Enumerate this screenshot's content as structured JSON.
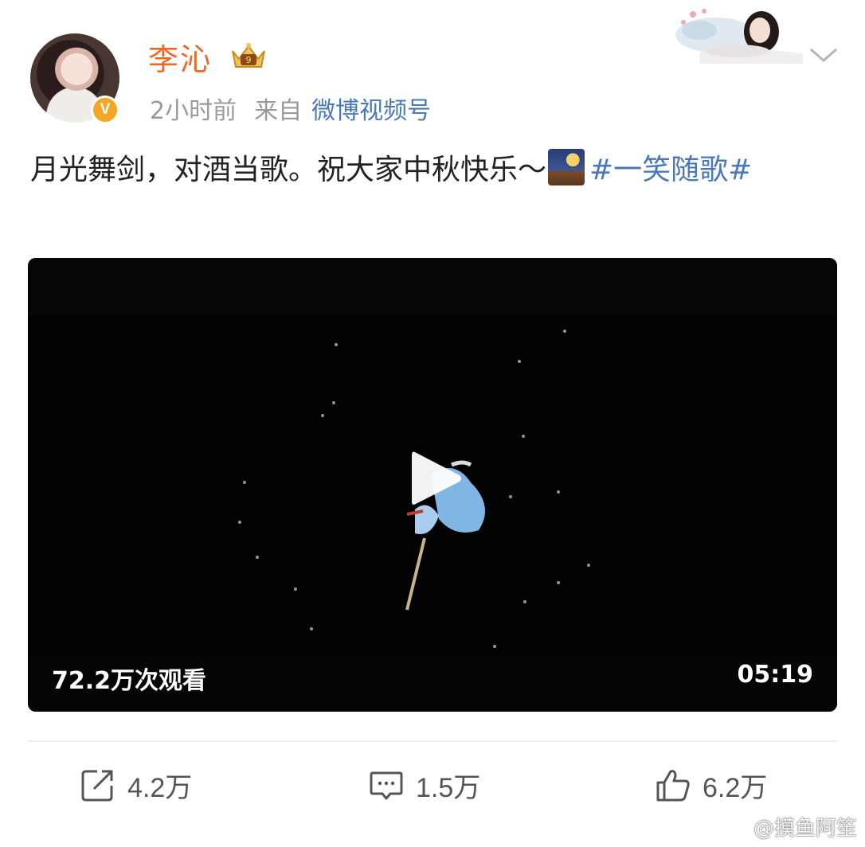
{
  "user": {
    "name": "李沁",
    "verified_badge": "V",
    "time": "2小时前",
    "source_prefix": "来自",
    "source": "微博视频号"
  },
  "post": {
    "text": "月光舞剑，对酒当歌。祝大家中秋快乐～",
    "emoji": "moon-festival-emoji",
    "topic": "#一笑随歌#"
  },
  "video": {
    "views": "72.2万次观看",
    "duration": "05:19",
    "play_icon": "play-icon"
  },
  "actions": {
    "repost": "4.2万",
    "comment": "1.5万",
    "like": "6.2万"
  },
  "watermark": "@摸鱼阿笙",
  "colors": {
    "username": "#e86a25",
    "link": "#4a78b8",
    "meta": "#9a9a9a",
    "verified": "#f5a623"
  }
}
